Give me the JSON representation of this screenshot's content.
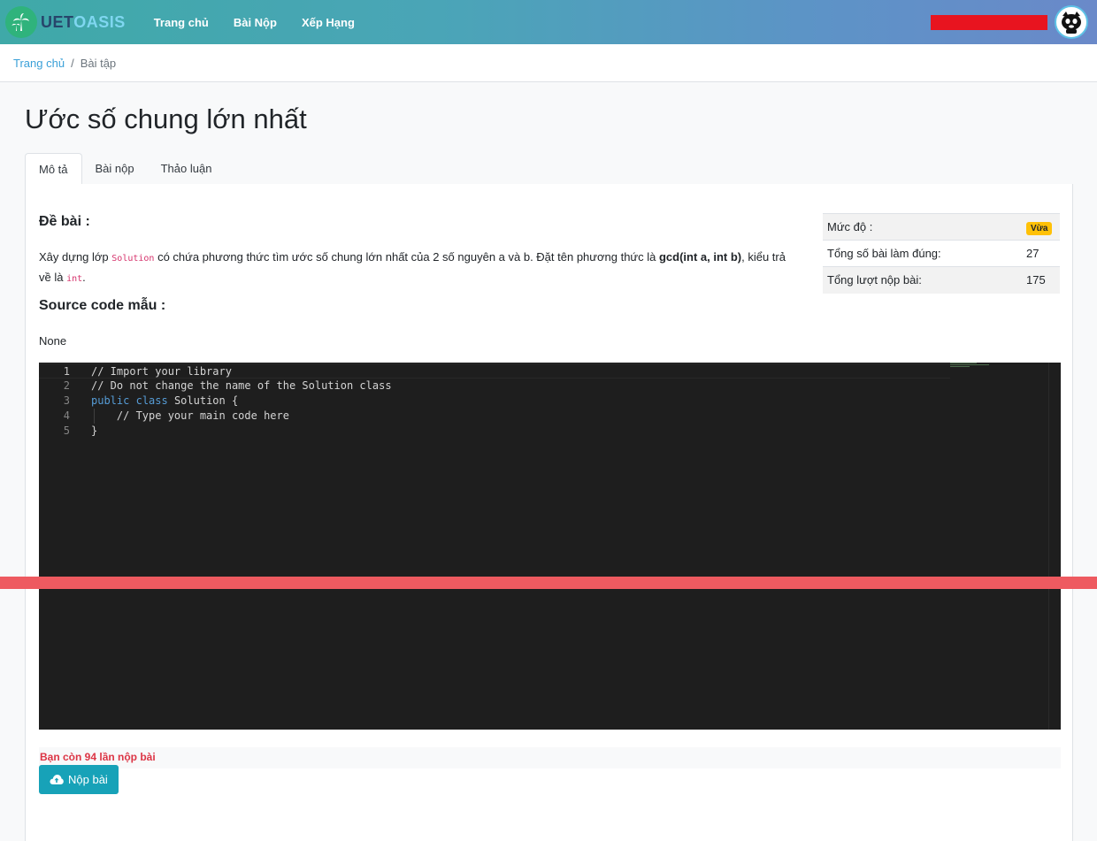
{
  "navbar": {
    "brand_uet": "UET",
    "brand_oasis": "OASIS",
    "links": [
      "Trang chủ",
      "Bài Nộp",
      "Xếp Hạng"
    ],
    "accent_color": "#17a2b8"
  },
  "breadcrumb": {
    "home": "Trang chủ",
    "separator": "/",
    "current": "Bài tập"
  },
  "problem": {
    "title": "Ước số chung lớn nhất",
    "tabs": [
      "Mô tả",
      "Bài nộp",
      "Thảo luận"
    ],
    "statement_heading": "Đề bài :",
    "desc_part1": "Xây dựng lớp ",
    "desc_code1": "Solution",
    "desc_part2": " có chứa phương thức tìm ước số chung lớn nhất của 2 số nguyên a và b. Đặt tên phương thức là ",
    "desc_bold": "gcd(int a, int b)",
    "desc_part3": ", kiểu trả về là ",
    "desc_code2": "int",
    "desc_part4": ".",
    "sample_heading": "Source code mẫu :",
    "sample_value": "None"
  },
  "stats": {
    "difficulty_label": "Mức độ :",
    "difficulty_value": "Vừa",
    "correct_label": "Tổng số bài làm đúng:",
    "correct_value": "27",
    "submissions_label": "Tổng lượt nộp bài:",
    "submissions_value": "175"
  },
  "editor": {
    "line_numbers": [
      "1",
      "2",
      "3",
      "4",
      "5"
    ],
    "line1": "// Import your library",
    "line2": "// Do not change the name of the Solution class",
    "line3_kw1": "public",
    "line3_kw2": "class",
    "line3_rest": " Solution {",
    "line4": "    // Type your main code here",
    "line5": "}"
  },
  "submit": {
    "remaining_text": "Bạn còn 94 lần nộp bài",
    "button_label": "Nộp bài"
  }
}
